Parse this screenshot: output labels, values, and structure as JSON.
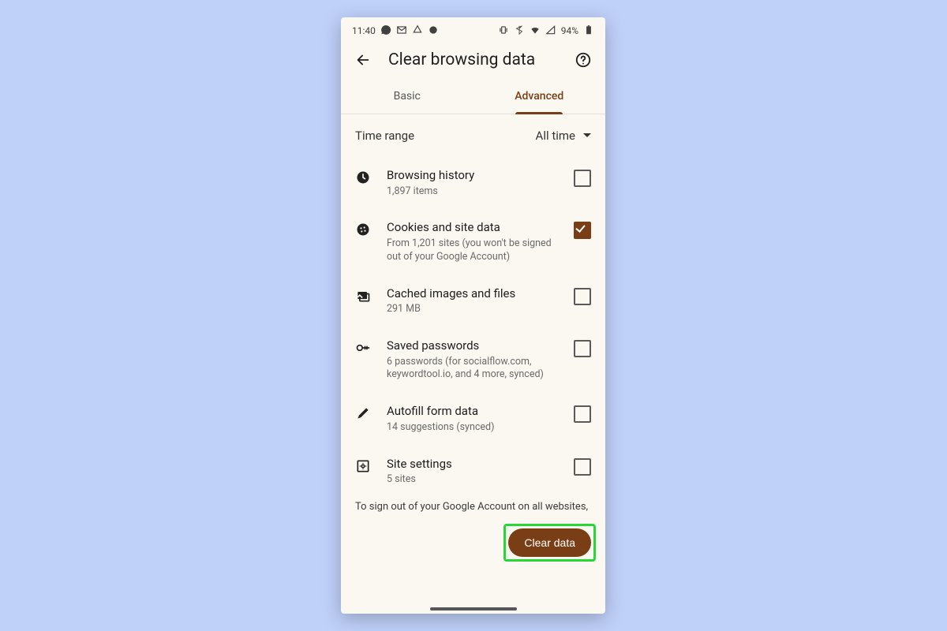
{
  "status": {
    "time": "11:40",
    "battery": "94%"
  },
  "header": {
    "title": "Clear browsing data"
  },
  "tabs": {
    "basic": "Basic",
    "advanced": "Advanced",
    "active": "advanced"
  },
  "time_range": {
    "label": "Time range",
    "value": "All time"
  },
  "items": [
    {
      "id": "browsing-history",
      "title": "Browsing history",
      "sub": "1,897 items",
      "icon": "clock-icon",
      "checked": false
    },
    {
      "id": "cookies",
      "title": "Cookies and site data",
      "sub": "From 1,201 sites (you won't be signed out of your Google Account)",
      "icon": "cookie-icon",
      "checked": true
    },
    {
      "id": "cache",
      "title": "Cached images and files",
      "sub": "291 MB",
      "icon": "image-icon",
      "checked": false
    },
    {
      "id": "passwords",
      "title": "Saved passwords",
      "sub": "6 passwords (for socialflow.com, keywordtool.io, and 4 more, synced)",
      "icon": "key-icon",
      "checked": false
    },
    {
      "id": "autofill",
      "title": "Autofill form data",
      "sub": "14 suggestions (synced)",
      "icon": "pencil-icon",
      "checked": false
    },
    {
      "id": "site-settings",
      "title": "Site settings",
      "sub": "5 sites",
      "icon": "site-settings-icon",
      "checked": false
    }
  ],
  "footnote": "To sign out of your Google Account on all websites,",
  "clear_button": "Clear data",
  "colors": {
    "accent": "#7a3e16",
    "highlight": "#29d63a"
  }
}
